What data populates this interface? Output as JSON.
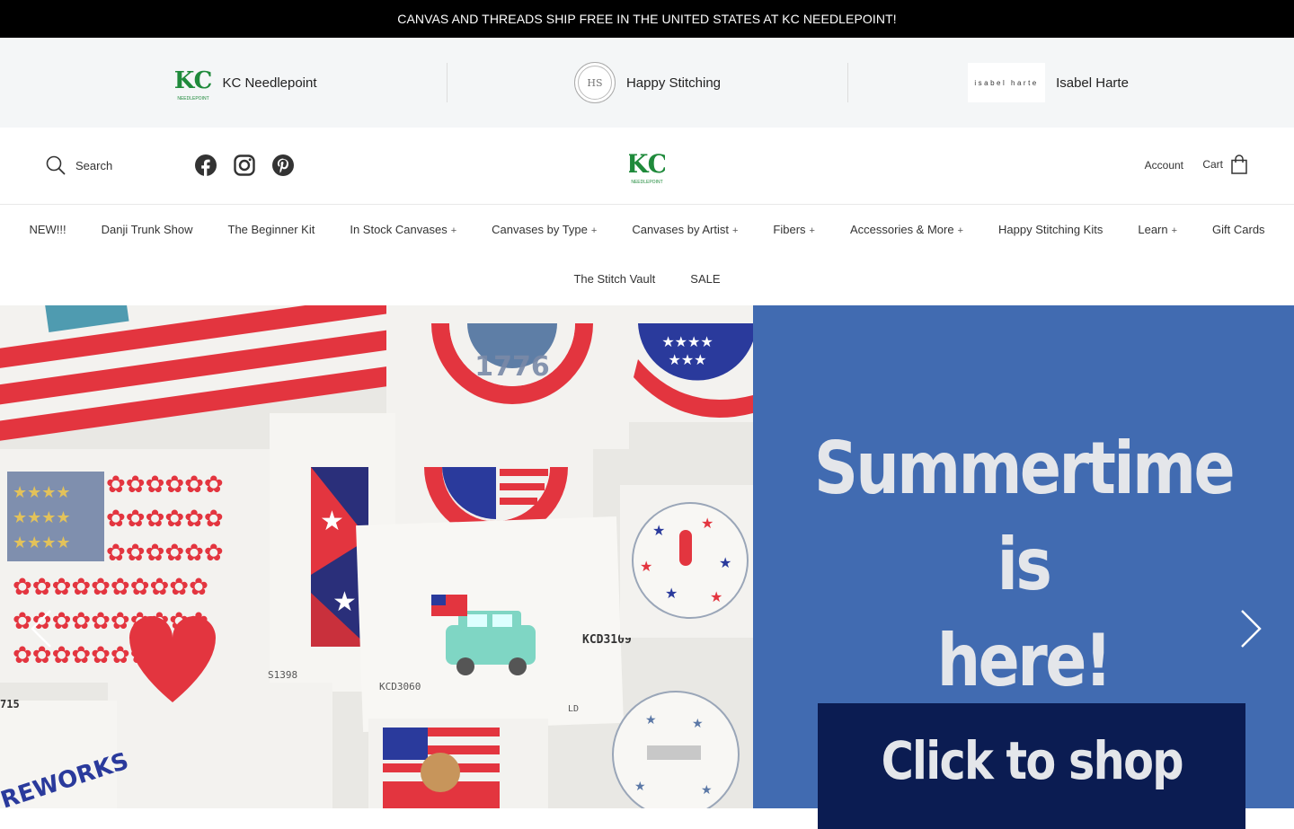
{
  "announcement": "CANVAS AND THREADS SHIP FREE IN THE UNITED STATES AT KC NEEDLEPOINT!",
  "brands": [
    {
      "name": "KC Needlepoint",
      "logo_text": "KC",
      "logo_sub": "NEEDLEPOINT"
    },
    {
      "name": "Happy Stitching",
      "logo_text": "HS"
    },
    {
      "name": "Isabel Harte",
      "logo_text": "isabel harte"
    }
  ],
  "header": {
    "search_label": "Search",
    "logo_text": "KC",
    "logo_sub": "NEEDLEPOINT",
    "account_label": "Account",
    "cart_label": "Cart",
    "social_icons": [
      "facebook-icon",
      "instagram-icon",
      "pinterest-icon"
    ]
  },
  "nav": {
    "row1": [
      {
        "label": "NEW!!!",
        "has_submenu": false
      },
      {
        "label": "Danji Trunk Show",
        "has_submenu": false
      },
      {
        "label": "The Beginner Kit",
        "has_submenu": false
      },
      {
        "label": "In Stock Canvases",
        "has_submenu": true
      },
      {
        "label": "Canvases by Type",
        "has_submenu": true
      },
      {
        "label": "Canvases by Artist",
        "has_submenu": true
      },
      {
        "label": "Fibers",
        "has_submenu": true
      },
      {
        "label": "Accessories & More",
        "has_submenu": true
      },
      {
        "label": "Happy Stitching Kits",
        "has_submenu": false
      },
      {
        "label": "Learn",
        "has_submenu": true
      },
      {
        "label": "Gift Cards",
        "has_submenu": false
      }
    ],
    "row2": [
      {
        "label": "The Stitch Vault",
        "has_submenu": false
      },
      {
        "label": "SALE",
        "has_submenu": false
      }
    ],
    "submenu_marker": "+"
  },
  "hero": {
    "headline_line1": "Summertime is",
    "headline_line2": "here!",
    "cta_label": "Click to shop",
    "colors": {
      "panel": "#416bb1",
      "cta": "#0b1c52",
      "text": "#e4e6ea"
    },
    "canvas_labels": [
      "1776",
      "S1398",
      "KCD3060",
      "KCD3109",
      "LD",
      "715",
      "REWORKS"
    ]
  },
  "colors": {
    "brand_green": "#1f8a3b",
    "announcement_bg": "#000000"
  }
}
